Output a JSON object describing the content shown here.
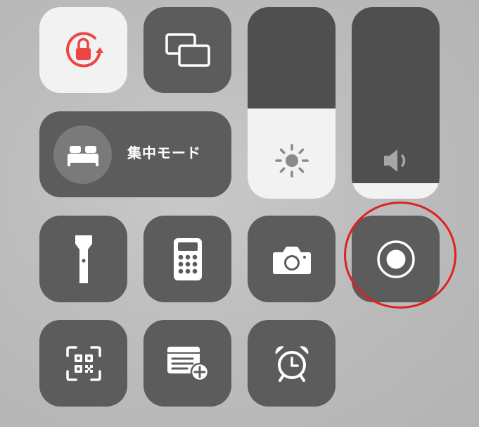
{
  "colors": {
    "tile_dark": "#5c5c5c",
    "tile_light": "#f2f2f2",
    "lock_accent": "#ee4444",
    "slider_fill": "#f2f2f2",
    "annotation_ring": "#e02020"
  },
  "tiles": {
    "rotation_lock": {
      "icon": "rotation-lock-icon",
      "state": "on"
    },
    "screen_mirroring": {
      "icon": "screen-mirroring-icon"
    },
    "focus": {
      "label": "集中モード",
      "icon": "bed-icon"
    },
    "brightness": {
      "icon": "sun-icon",
      "level": 0.47
    },
    "volume": {
      "icon": "speaker-icon",
      "level": 0.08
    },
    "flashlight": {
      "icon": "flashlight-icon"
    },
    "calculator": {
      "icon": "calculator-icon"
    },
    "camera": {
      "icon": "camera-icon"
    },
    "screen_recording": {
      "icon": "record-icon",
      "highlighted": true
    },
    "code_scanner": {
      "icon": "qr-code-scanner-icon"
    },
    "quick_note": {
      "icon": "quick-note-icon"
    },
    "alarm": {
      "icon": "alarm-clock-icon"
    }
  }
}
